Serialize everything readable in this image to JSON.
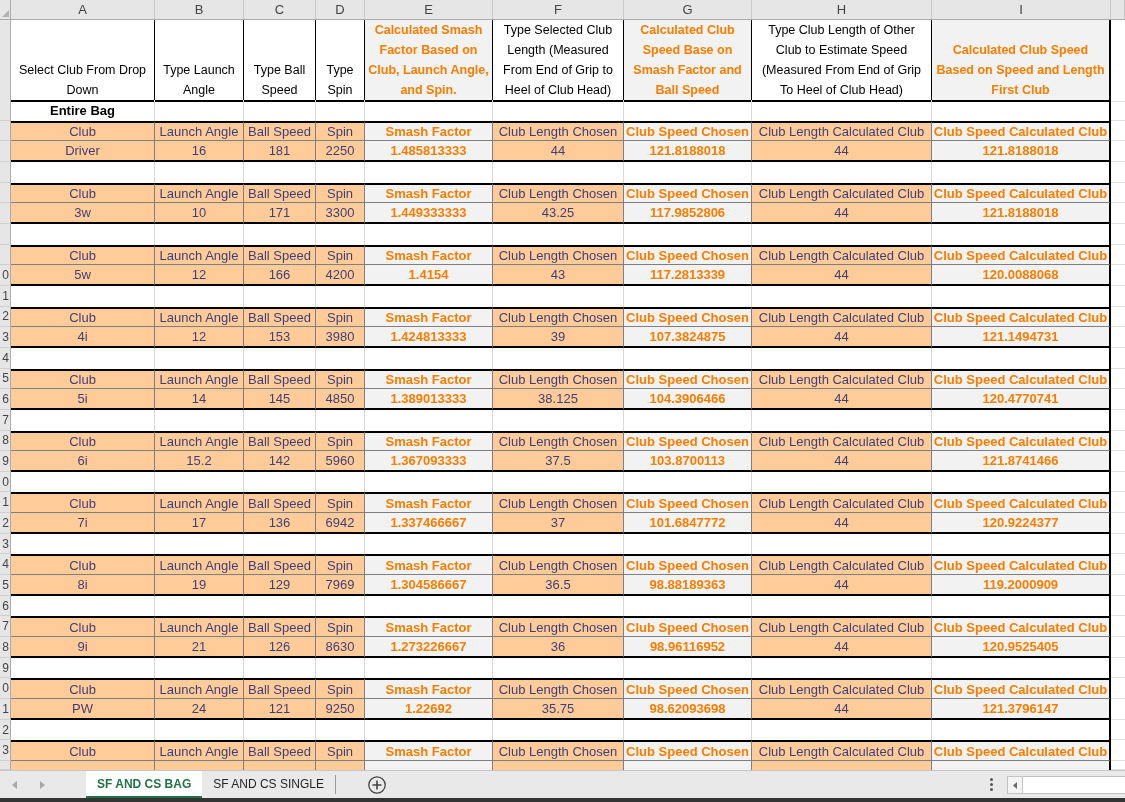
{
  "sheet": {
    "columns": [
      {
        "letter": "A",
        "kind": "input",
        "heading": "Select Club From Drop Down"
      },
      {
        "letter": "B",
        "kind": "input",
        "heading": "Type Launch Angle"
      },
      {
        "letter": "C",
        "kind": "input",
        "heading": "Type Ball Speed"
      },
      {
        "letter": "D",
        "kind": "input",
        "heading": "Type Spin"
      },
      {
        "letter": "E",
        "kind": "calculated",
        "heading": "Calculated Smash Factor Based on Club, Launch Angle, and Spin."
      },
      {
        "letter": "F",
        "kind": "input",
        "heading": "Type Selected Club Length (Measured From End of Grip to Heel of Club Head)"
      },
      {
        "letter": "G",
        "kind": "calculated",
        "heading": "Calculated Club Speed Base on Smash Factor and Ball Speed"
      },
      {
        "letter": "H",
        "kind": "input",
        "heading": "Type Club Length of Other Club to Estimate Speed (Measured From End of Grip To Heel of Club Head)"
      },
      {
        "letter": "I",
        "kind": "calculated",
        "heading": "Calculated Club Speed Based on Speed and Length First Club"
      }
    ],
    "rows": [
      {
        "kind": "section",
        "cells": [
          "Entire Bag"
        ]
      },
      {
        "kind": "labels",
        "cells": [
          "Club",
          "Launch Angle",
          "Ball Speed",
          "Spin",
          "Smash Factor",
          "Club Length Chosen",
          "Club Speed Chosen",
          "Club Length Calculated Club",
          "Club Speed Calculated Club"
        ]
      },
      {
        "kind": "values",
        "cells": [
          "Driver",
          "16",
          "181",
          "2250",
          "1.485813333",
          "44",
          "121.8188018",
          "44",
          "121.8188018"
        ]
      },
      {
        "kind": "blank"
      },
      {
        "kind": "labels",
        "cells": [
          "Club",
          "Launch Angle",
          "Ball Speed",
          "Spin",
          "Smash Factor",
          "Club Length Chosen",
          "Club Speed Chosen",
          "Club Length Calculated Club",
          "Club Speed Calculated Club"
        ]
      },
      {
        "kind": "values",
        "cells": [
          "3w",
          "10",
          "171",
          "3300",
          "1.449333333",
          "43.25",
          "117.9852806",
          "44",
          "121.8188018"
        ]
      },
      {
        "kind": "blank"
      },
      {
        "kind": "labels",
        "cells": [
          "Club",
          "Launch Angle",
          "Ball Speed",
          "Spin",
          "Smash Factor",
          "Club Length Chosen",
          "Club Speed Chosen",
          "Club Length Calculated Club",
          "Club Speed Calculated Club"
        ]
      },
      {
        "kind": "values",
        "row_number": "0",
        "cells": [
          "5w",
          "12",
          "166",
          "4200",
          "1.4154",
          "43",
          "117.2813339",
          "44",
          "120.0088068"
        ]
      },
      {
        "kind": "blank",
        "row_number": "1"
      },
      {
        "kind": "labels",
        "row_number": "2",
        "cells": [
          "Club",
          "Launch Angle",
          "Ball Speed",
          "Spin",
          "Smash Factor",
          "Club Length Chosen",
          "Club Speed Chosen",
          "Club Length Calculated Club",
          "Club Speed Calculated Club"
        ]
      },
      {
        "kind": "values",
        "row_number": "3",
        "cells": [
          "4i",
          "12",
          "153",
          "3980",
          "1.424813333",
          "39",
          "107.3824875",
          "44",
          "121.1494731"
        ]
      },
      {
        "kind": "blank",
        "row_number": "4"
      },
      {
        "kind": "labels",
        "row_number": "5",
        "cells": [
          "Club",
          "Launch Angle",
          "Ball Speed",
          "Spin",
          "Smash Factor",
          "Club Length Chosen",
          "Club Speed Chosen",
          "Club Length Calculated Club",
          "Club Speed Calculated Club"
        ]
      },
      {
        "kind": "values",
        "row_number": "6",
        "cells": [
          "5i",
          "14",
          "145",
          "4850",
          "1.389013333",
          "38.125",
          "104.3906466",
          "44",
          "120.4770741"
        ]
      },
      {
        "kind": "blank",
        "row_number": "7"
      },
      {
        "kind": "labels",
        "row_number": "8",
        "cells": [
          "Club",
          "Launch Angle",
          "Ball Speed",
          "Spin",
          "Smash Factor",
          "Club Length Chosen",
          "Club Speed Chosen",
          "Club Length Calculated Club",
          "Club Speed Calculated Club"
        ]
      },
      {
        "kind": "values",
        "row_number": "9",
        "cells": [
          "6i",
          "15.2",
          "142",
          "5960",
          "1.367093333",
          "37.5",
          "103.8700113",
          "44",
          "121.8741466"
        ]
      },
      {
        "kind": "blank",
        "row_number": "0"
      },
      {
        "kind": "labels",
        "row_number": "1",
        "cells": [
          "Club",
          "Launch Angle",
          "Ball Speed",
          "Spin",
          "Smash Factor",
          "Club Length Chosen",
          "Club Speed Chosen",
          "Club Length Calculated Club",
          "Club Speed Calculated Club"
        ]
      },
      {
        "kind": "values",
        "row_number": "2",
        "cells": [
          "7i",
          "17",
          "136",
          "6942",
          "1.337466667",
          "37",
          "101.6847772",
          "44",
          "120.9224377"
        ]
      },
      {
        "kind": "blank",
        "row_number": "3"
      },
      {
        "kind": "labels",
        "row_number": "4",
        "cells": [
          "Club",
          "Launch Angle",
          "Ball Speed",
          "Spin",
          "Smash Factor",
          "Club Length Chosen",
          "Club Speed Chosen",
          "Club Length Calculated Club",
          "Club Speed Calculated Club"
        ]
      },
      {
        "kind": "values",
        "row_number": "5",
        "cells": [
          "8i",
          "19",
          "129",
          "7969",
          "1.304586667",
          "36.5",
          "98.88189363",
          "44",
          "119.2000909"
        ]
      },
      {
        "kind": "blank",
        "row_number": "6"
      },
      {
        "kind": "labels",
        "row_number": "7",
        "cells": [
          "Club",
          "Launch Angle",
          "Ball Speed",
          "Spin",
          "Smash Factor",
          "Club Length Chosen",
          "Club Speed Chosen",
          "Club Length Calculated Club",
          "Club Speed Calculated Club"
        ]
      },
      {
        "kind": "values",
        "row_number": "8",
        "cells": [
          "9i",
          "21",
          "126",
          "8630",
          "1.273226667",
          "36",
          "98.96116952",
          "44",
          "120.9525405"
        ]
      },
      {
        "kind": "blank",
        "row_number": "9"
      },
      {
        "kind": "labels",
        "row_number": "0",
        "cells": [
          "Club",
          "Launch Angle",
          "Ball Speed",
          "Spin",
          "Smash Factor",
          "Club Length Chosen",
          "Club Speed Chosen",
          "Club Length Calculated Club",
          "Club Speed Calculated Club"
        ]
      },
      {
        "kind": "values",
        "row_number": "1",
        "cells": [
          "PW",
          "24",
          "121",
          "9250",
          "1.22692",
          "35.75",
          "98.62093698",
          "44",
          "121.3796147"
        ]
      },
      {
        "kind": "blank",
        "row_number": "2"
      },
      {
        "kind": "labels",
        "row_number": "3",
        "cells": [
          "Club",
          "Launch Angle",
          "Ball Speed",
          "Spin",
          "Smash Factor",
          "Club Length Chosen",
          "Club Speed Chosen",
          "Club Length Calculated Club",
          "Club Speed Calculated Club"
        ]
      },
      {
        "kind": "values"
      }
    ]
  },
  "sheet_tabs": [
    {
      "label": "SF AND CS BAG",
      "selected": true
    },
    {
      "label": "SF AND CS SINGLE",
      "selected": false
    }
  ]
}
